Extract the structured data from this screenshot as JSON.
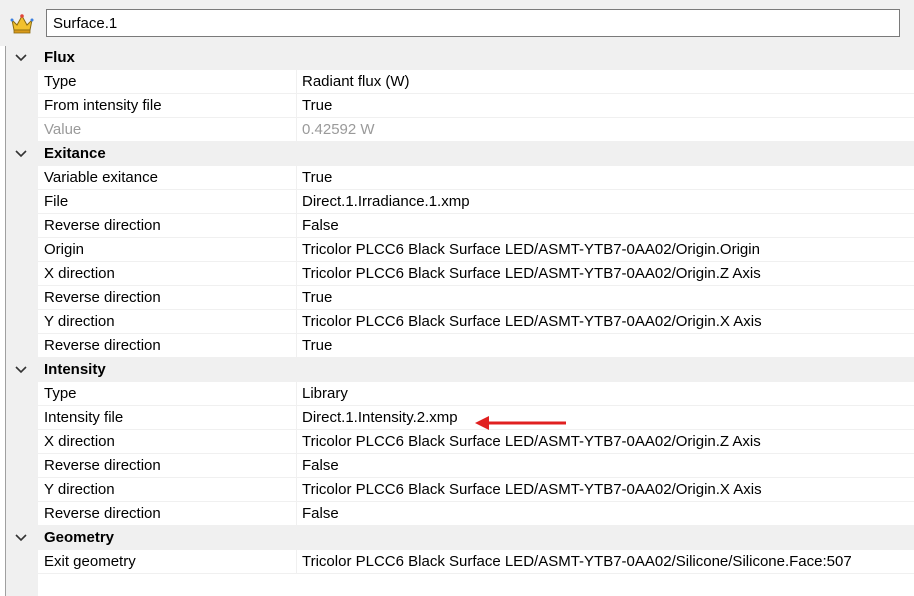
{
  "header": {
    "name_value": "Surface.1",
    "icon": "crown-icon"
  },
  "categories": [
    {
      "label": "Flux",
      "rows": [
        {
          "name": "Type",
          "value": "Radiant flux (W)"
        },
        {
          "name": "From intensity file",
          "value": "True"
        },
        {
          "name": "Value",
          "value": "0.42592 W",
          "disabled": true
        }
      ]
    },
    {
      "label": "Exitance",
      "rows": [
        {
          "name": "Variable exitance",
          "value": "True"
        },
        {
          "name": "File",
          "value": "Direct.1.Irradiance.1.xmp"
        },
        {
          "name": "Reverse direction",
          "value": "False"
        },
        {
          "name": "Origin",
          "value": "Tricolor PLCC6 Black Surface LED/ASMT-YTB7-0AA02/Origin.Origin"
        },
        {
          "name": "X direction",
          "value": "Tricolor PLCC6 Black Surface LED/ASMT-YTB7-0AA02/Origin.Z Axis"
        },
        {
          "name": "Reverse direction",
          "value": "True"
        },
        {
          "name": "Y direction",
          "value": "Tricolor PLCC6 Black Surface LED/ASMT-YTB7-0AA02/Origin.X Axis"
        },
        {
          "name": "Reverse direction",
          "value": "True"
        }
      ]
    },
    {
      "label": "Intensity",
      "rows": [
        {
          "name": "Type",
          "value": "Library"
        },
        {
          "name": "Intensity file",
          "value": "Direct.1.Intensity.2.xmp"
        },
        {
          "name": "X direction",
          "value": "Tricolor PLCC6 Black Surface LED/ASMT-YTB7-0AA02/Origin.Z Axis"
        },
        {
          "name": "Reverse direction",
          "value": "False"
        },
        {
          "name": "Y direction",
          "value": "Tricolor PLCC6 Black Surface LED/ASMT-YTB7-0AA02/Origin.X Axis"
        },
        {
          "name": "Reverse direction",
          "value": "False"
        }
      ]
    },
    {
      "label": "Geometry",
      "rows": [
        {
          "name": "Exit geometry",
          "value": "Tricolor PLCC6 Black Surface LED/ASMT-YTB7-0AA02/Silicone/Silicone.Face:507"
        }
      ]
    }
  ],
  "annotation": {
    "color": "#e02020",
    "target": "Intensity file"
  },
  "colors": {
    "header_bg": "#f0f0f0",
    "disabled_text": "#9a9a9a",
    "grid_line": "#f0f0f0"
  }
}
